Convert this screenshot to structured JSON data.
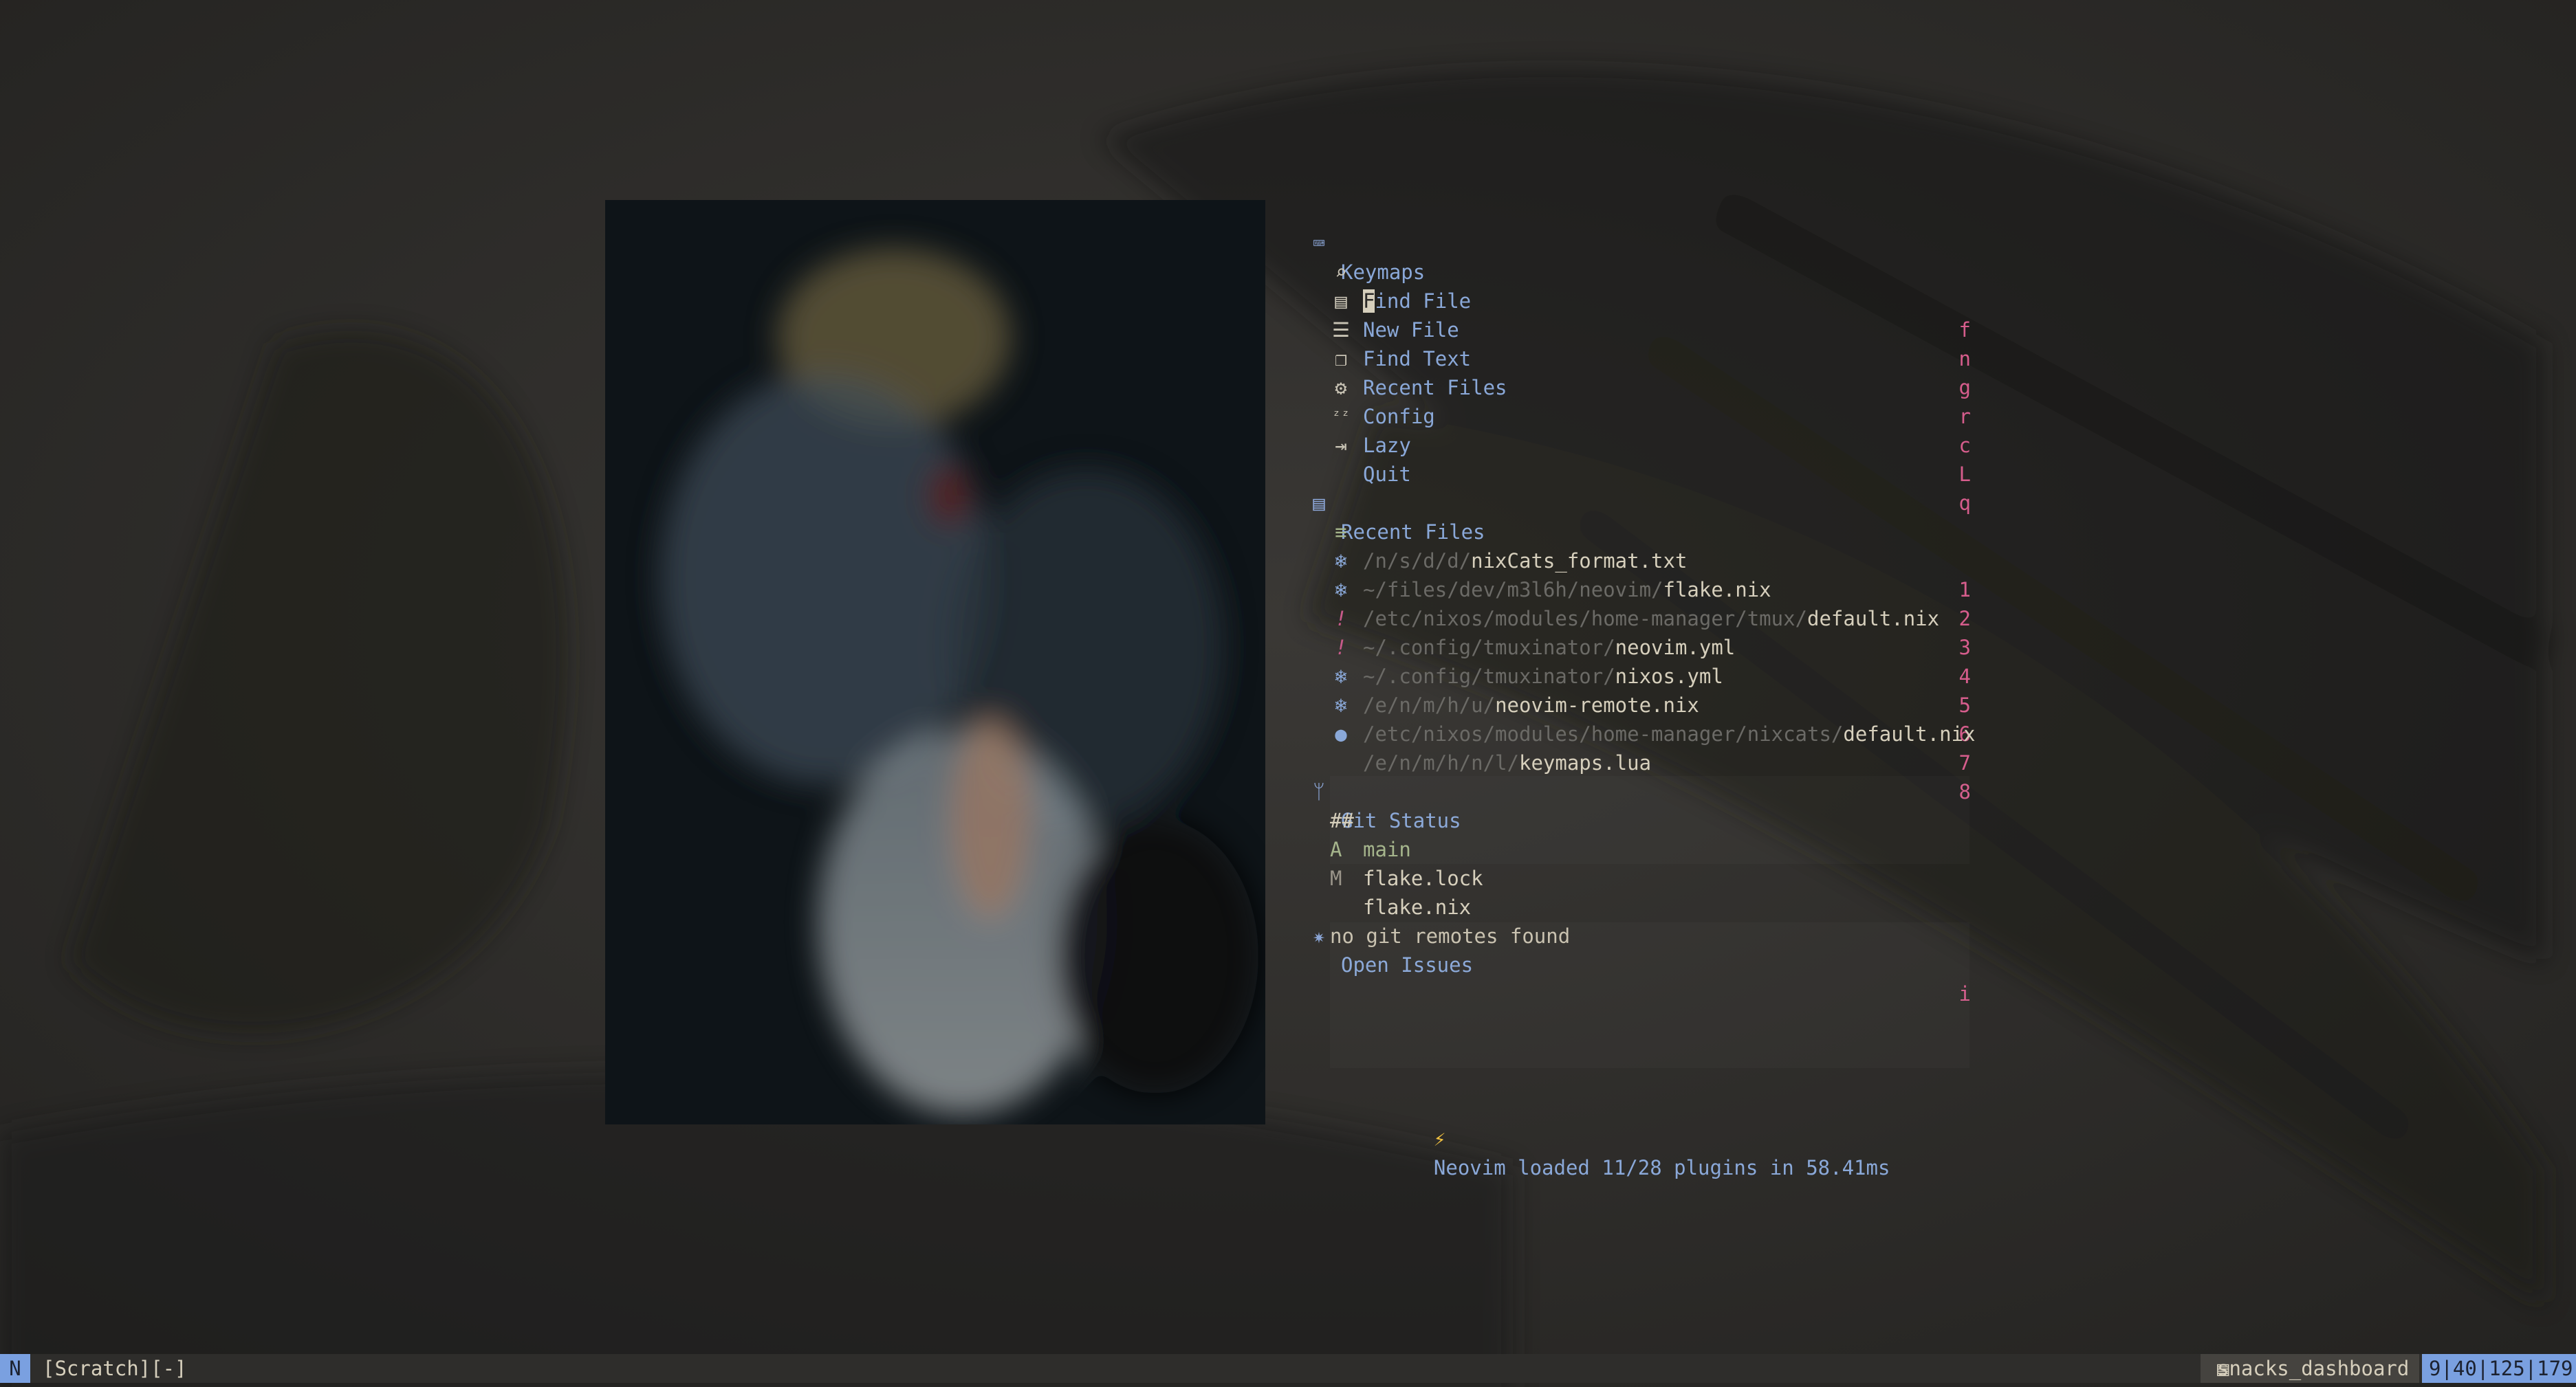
{
  "keymaps": {
    "title": "Keymaps",
    "items": [
      {
        "icon": "search-icon",
        "label": "Find File",
        "key": "f"
      },
      {
        "icon": "file-icon",
        "label": "New File",
        "key": "n"
      },
      {
        "icon": "text-icon",
        "label": "Find Text",
        "key": "g"
      },
      {
        "icon": "copy-icon",
        "label": "Recent Files",
        "key": "r"
      },
      {
        "icon": "gear-icon",
        "label": "Config",
        "key": "c"
      },
      {
        "icon": "sleep-icon",
        "label": "Lazy",
        "key": "L"
      },
      {
        "icon": "exit-icon",
        "label": "Quit",
        "key": "q"
      }
    ]
  },
  "recent": {
    "title": "Recent Files",
    "items": [
      {
        "icon": "text-file-icon",
        "dir": "/n/s/d/d/",
        "name": "nixCats_format.txt",
        "key": "1"
      },
      {
        "icon": "nix-icon",
        "dir": "~/files/dev/m3l6h/neovim/",
        "name": "flake.nix",
        "key": "2"
      },
      {
        "icon": "nix-icon",
        "dir": "/etc/nixos/modules/home-manager/tmux/",
        "name": "default.nix",
        "key": "3"
      },
      {
        "icon": "yaml-icon",
        "dir": "~/.config/tmuxinator/",
        "name": "neovim.yml",
        "key": "4"
      },
      {
        "icon": "yaml-icon",
        "dir": "~/.config/tmuxinator/",
        "name": "nixos.yml",
        "key": "5"
      },
      {
        "icon": "nix-icon",
        "dir": "/e/n/m/h/u/",
        "name": "neovim-remote.nix",
        "key": "6"
      },
      {
        "icon": "nix-icon",
        "dir": "/etc/nixos/modules/home-manager/nixcats/",
        "name": "default.nix",
        "key": "7"
      },
      {
        "icon": "lua-icon",
        "dir": "/e/n/m/h/n/l/",
        "name": "keymaps.lua",
        "key": "8"
      }
    ]
  },
  "git": {
    "title": "Git Status",
    "branch_flag": "##",
    "branch": "main",
    "files": [
      {
        "flag": "A",
        "name": "flake.lock"
      },
      {
        "flag": "M",
        "name": "flake.nix"
      }
    ]
  },
  "issues": {
    "title": "Open Issues",
    "key": "i",
    "message": "no git remotes found"
  },
  "footer": {
    "bolt": "⚡",
    "prefix": "Neovim loaded ",
    "loaded": "11/28",
    "mid": " plugins in ",
    "time": "58.41ms"
  },
  "statusline": {
    "mode": "N",
    "buffer": "[Scratch][-]",
    "filetype": "snacks_dashboard",
    "position": "9|40|125|179"
  },
  "colors": {
    "accent": "#8aa8d8",
    "key": "#d65d8c",
    "mode_bg": "#7aa0e0"
  }
}
